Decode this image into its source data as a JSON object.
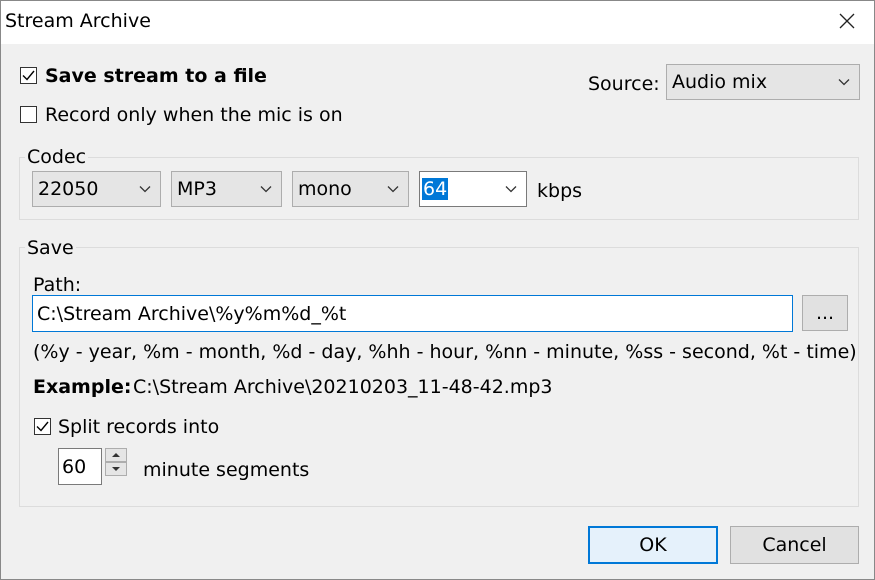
{
  "window": {
    "title": "Stream Archive"
  },
  "save_to_file": {
    "label": "Save stream to a file",
    "checked": true
  },
  "record_mic": {
    "label": "Record only when the mic is on",
    "checked": false
  },
  "source": {
    "label": "Source:",
    "value": "Audio mix"
  },
  "codec": {
    "group_label": "Codec",
    "sample_rate": "22050",
    "format": "MP3",
    "channels": "mono",
    "bitrate": "64",
    "bitrate_unit": "kbps"
  },
  "save": {
    "group_label": "Save",
    "path_label": "Path:",
    "path_value": "C:\\Stream Archive\\%y%m%d_%t",
    "browse_label": "...",
    "hint": "(%y - year, %m - month, %d - day, %hh - hour, %nn - minute, %ss - second, %t - time)",
    "example_label": "Example:",
    "example_value": "C:\\Stream Archive\\20210203_11-48-42.mp3",
    "split": {
      "label": "Split records into",
      "checked": true
    },
    "minutes_value": "60",
    "minutes_label": "minute segments"
  },
  "buttons": {
    "ok": "OK",
    "cancel": "Cancel"
  }
}
